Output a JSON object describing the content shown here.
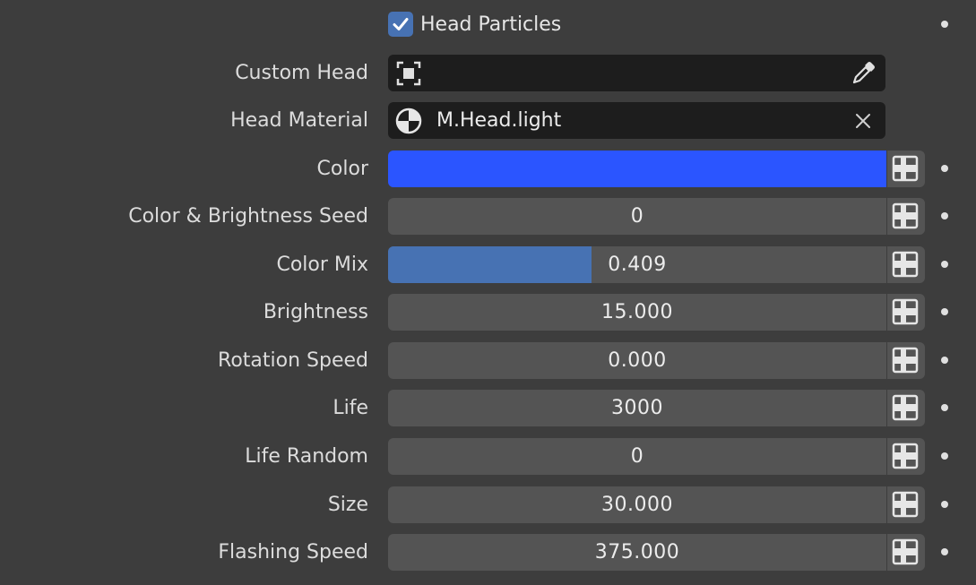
{
  "head_particles": {
    "label": "Head Particles",
    "checked": true
  },
  "custom_head": {
    "label": "Custom Head",
    "icon": "object-select-icon",
    "picker_icon": "eyedropper-icon"
  },
  "head_material": {
    "label": "Head Material",
    "value": "M.Head.light",
    "icon": "material-sphere-icon",
    "clear_icon": "close-icon"
  },
  "color": {
    "label": "Color",
    "hex": "#2b55ff"
  },
  "fields": [
    {
      "label": "Color & Brightness Seed",
      "value": "0"
    },
    {
      "label": "Color Mix",
      "value": "0.409",
      "fill_fraction": 0.409
    },
    {
      "label": "Brightness",
      "value": "15.000"
    },
    {
      "label": "Rotation Speed",
      "value": "0.000"
    },
    {
      "label": "Life",
      "value": "3000"
    },
    {
      "label": "Life Random",
      "value": "0"
    },
    {
      "label": "Size",
      "value": "30.000"
    },
    {
      "label": "Flashing Speed",
      "value": "375.000"
    }
  ],
  "colors": {
    "background": "#3d3d3d",
    "field": "#545454",
    "dark_field": "#1d1d1d",
    "accent": "#4772b3"
  }
}
